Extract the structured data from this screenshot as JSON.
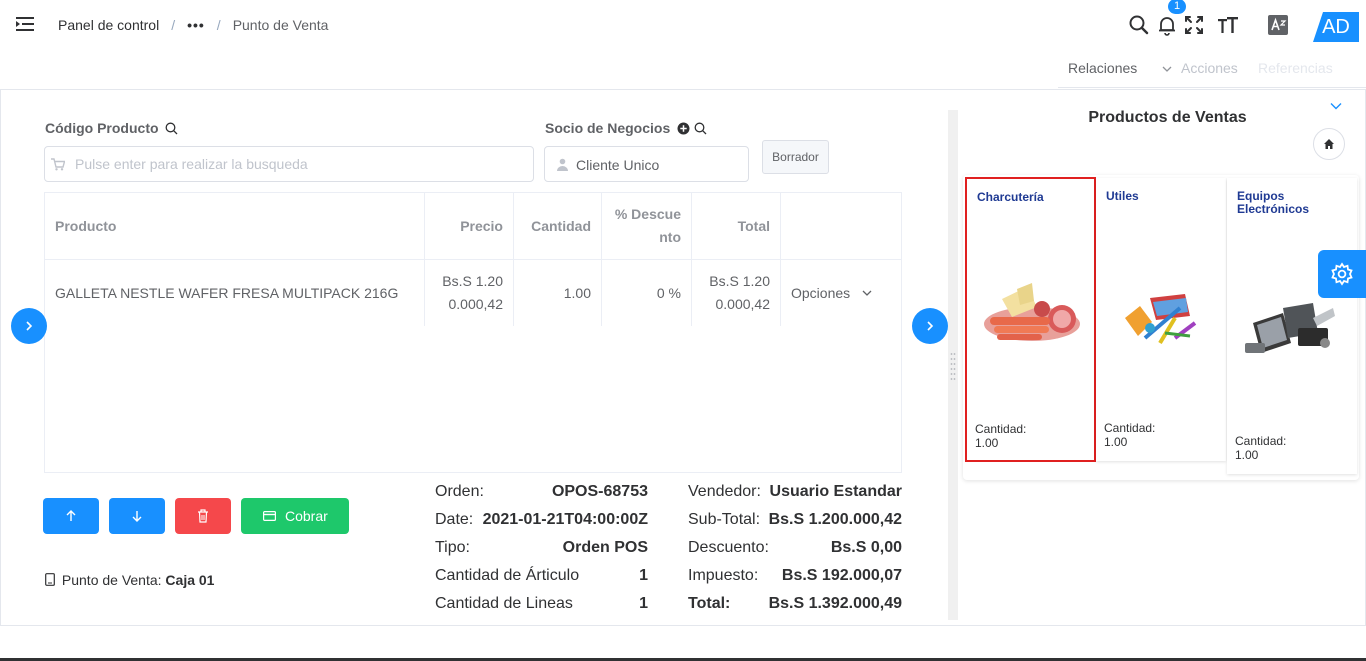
{
  "header": {
    "breadcrumb": {
      "home": "Panel de control",
      "more": "•••",
      "separator": "/",
      "current": "Punto de Venta"
    },
    "notification_count": "1",
    "avatar_initials": "AD",
    "icons": [
      "menu-fold-icon",
      "search-icon",
      "bell-icon",
      "fullscreen-icon",
      "text-size-icon",
      "translate-icon"
    ]
  },
  "relations_tabs": {
    "relaciones": "Relaciones",
    "acciones": "Acciones",
    "referencias": "Referencias"
  },
  "form": {
    "product_code_label": "Código Producto",
    "product_search_placeholder": "Pulse enter para realizar la busqueda",
    "partner_label": "Socio de Negocios",
    "partner_value": "Cliente Unico",
    "draft_button": "Borrador"
  },
  "table": {
    "headers": {
      "producto": "Producto",
      "precio": "Precio",
      "cantidad": "Cantidad",
      "descuento_1": "% Descue",
      "descuento_2": "nto",
      "total": "Total"
    },
    "rows": [
      {
        "producto": "GALLETA NESTLE WAFER FRESA MULTIPACK 216G",
        "precio_1": "Bs.S 1.20",
        "precio_2": "0.000,42",
        "cantidad": "1.00",
        "descuento": "0 %",
        "total_1": "Bs.S 1.20",
        "total_2": "0.000,42",
        "opciones": "Opciones"
      }
    ]
  },
  "actions": {
    "cobrar": "Cobrar",
    "terminal_label": "Punto de Venta:",
    "terminal_value": "Caja 01"
  },
  "summary": {
    "orden_label": "Orden:",
    "orden": "OPOS-68753",
    "date_label": "Date:",
    "date": "2021-01-21T04:00:00Z",
    "tipo_label": "Tipo:",
    "tipo": "Orden POS",
    "cant_articulo_label": "Cantidad de Árticulo",
    "cant_articulo": "1",
    "cant_lineas_label": "Cantidad de Lineas",
    "cant_lineas": "1",
    "vendedor_label": "Vendedor:",
    "vendedor": "Usuario Estandar",
    "subtotal_label": "Sub-Total:",
    "subtotal": "Bs.S 1.200.000,42",
    "descuento_label": "Descuento:",
    "descuento": "Bs.S 0,00",
    "impuesto_label": "Impuesto:",
    "impuesto": "Bs.S 192.000,07",
    "total_label": "Total:",
    "total": "Bs.S 1.392.000,49"
  },
  "products_panel": {
    "title": "Productos de Ventas",
    "cards": [
      {
        "name": "Charcutería",
        "qty_label": "Cantidad:",
        "qty": "1.00",
        "selected": true
      },
      {
        "name": "Utiles",
        "qty_label": "Cantidad:",
        "qty": "1.00",
        "selected": false
      },
      {
        "name": "Equipos Electrónicos",
        "qty_label": "Cantidad:",
        "qty": "1.00",
        "selected": false
      }
    ]
  },
  "colors": {
    "primary": "#1890ff",
    "danger": "#f5484b",
    "success": "#1ec86b",
    "selected_border": "#e02020",
    "card_title": "#1f3a93"
  }
}
